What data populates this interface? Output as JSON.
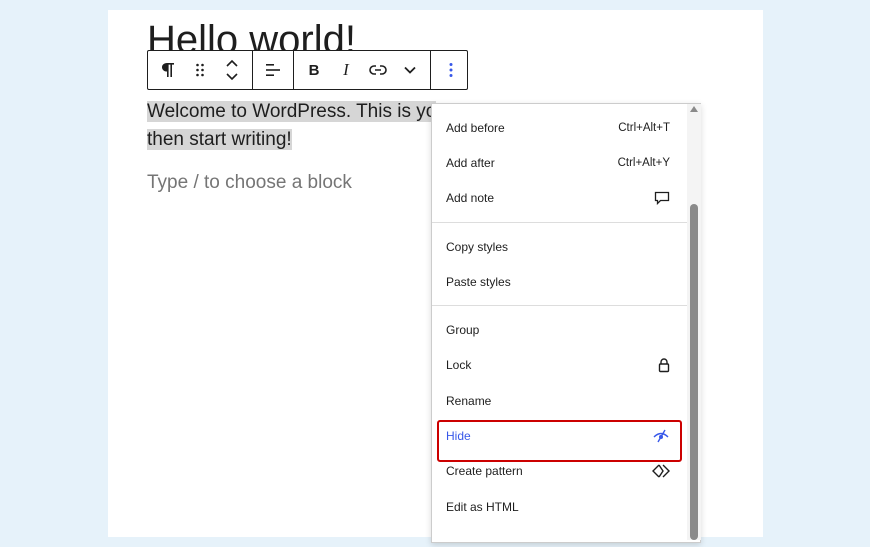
{
  "editor": {
    "title": "Hello world!",
    "paragraph_line1": "Welcome to WordPress. This is yo",
    "paragraph_line2": "then start writing!",
    "placeholder": "Type / to choose a block"
  },
  "toolbar": {
    "paragraph_icon": "pilcrow-icon",
    "drag_icon": "drag-handle-icon",
    "move_icon": "move-up-down-icon",
    "align_icon": "align-left-icon",
    "bold_label": "B",
    "italic_label": "I",
    "link_icon": "link-icon",
    "more_rich_icon": "chevron-down-icon",
    "options_icon": "more-vertical-icon"
  },
  "menu": {
    "sections": [
      {
        "items": [
          {
            "label": "Add before",
            "shortcut": "Ctrl+Alt+T"
          },
          {
            "label": "Add after",
            "shortcut": "Ctrl+Alt+Y"
          },
          {
            "label": "Add note",
            "icon": "comment-icon"
          }
        ]
      },
      {
        "items": [
          {
            "label": "Copy styles"
          },
          {
            "label": "Paste styles"
          }
        ]
      },
      {
        "items": [
          {
            "label": "Group"
          },
          {
            "label": "Lock",
            "icon": "lock-icon"
          },
          {
            "label": "Rename"
          },
          {
            "label": "Hide",
            "icon": "eye-hidden-icon"
          },
          {
            "label": "Create pattern",
            "icon": "symbol-icon"
          },
          {
            "label": "Edit as HTML"
          }
        ]
      }
    ]
  },
  "colors": {
    "accent": "#3858e9",
    "highlight_border": "#cc0000",
    "selection_bg": "#d6d6d6",
    "page_bg": "#e6f2fa"
  }
}
